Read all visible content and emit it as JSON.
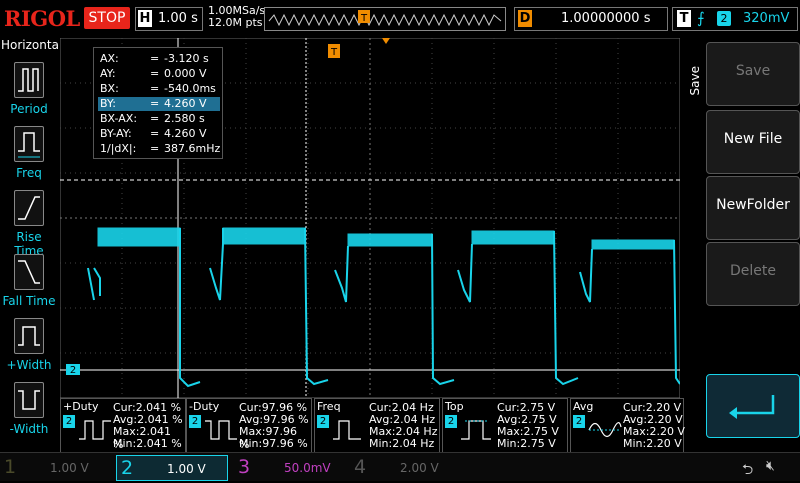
{
  "brand": "RIGOL",
  "run_state": "STOP",
  "horizontal": {
    "key": "H",
    "timebase": "1.00 s",
    "sample_rate": "1.00MSa/s",
    "points": "12.0M pts",
    "delay_key": "D",
    "delay": "1.00000000 s"
  },
  "trigger": {
    "key": "T",
    "channel": "2",
    "level": "320mV"
  },
  "left_panel": {
    "title": "Horizontal",
    "items": [
      "Period",
      "Freq",
      "Rise Time",
      "Fall Time",
      "+Width",
      "-Width"
    ]
  },
  "cursor": {
    "rows": [
      {
        "name": "AX:",
        "value": "-3.120 s"
      },
      {
        "name": "AY:",
        "value": "0.000 V"
      },
      {
        "name": "BX:",
        "value": "-540.0ms"
      },
      {
        "name": "BY:",
        "value": "4.260 V"
      },
      {
        "name": "BX-AX:",
        "value": "2.580 s"
      },
      {
        "name": "BY-AY:",
        "value": "4.260 V"
      },
      {
        "name": "1/|dX|:",
        "value": "387.6mHz"
      }
    ],
    "eq": "="
  },
  "right_panel": {
    "title": "Save",
    "buttons": [
      "Save",
      "New File",
      "NewFolder",
      "Delete"
    ]
  },
  "measurements": [
    {
      "title": "+Duty",
      "ch": "2",
      "cur": "Cur:2.041 %",
      "avg": "Avg:2.041 %",
      "max": "Max:2.041 %",
      "min": "Min:2.041 %"
    },
    {
      "title": "-Duty",
      "ch": "2",
      "cur": "Cur:97.96 %",
      "avg": "Avg:97.96 %",
      "max": "Max:97.96 %",
      "min": "Min:97.96 %"
    },
    {
      "title": "Freq",
      "ch": "2",
      "cur": "Cur:2.04 Hz",
      "avg": "Avg:2.04 Hz",
      "max": "Max:2.04 Hz",
      "min": "Min:2.04 Hz"
    },
    {
      "title": "Top",
      "ch": "2",
      "cur": "Cur:2.75 V",
      "avg": "Avg:2.75 V",
      "max": "Max:2.75 V",
      "min": "Min:2.75 V"
    },
    {
      "title": "Avg",
      "ch": "2",
      "cur": "Cur:2.20 V",
      "avg": "Avg:2.20 V",
      "max": "Max:2.20 V",
      "min": "Min:2.20 V"
    }
  ],
  "channels": [
    {
      "num": "1",
      "scale": "1.00 V",
      "color": "#4a4a2a"
    },
    {
      "num": "2",
      "scale": "1.00 V",
      "color": "#19d4ea"
    },
    {
      "num": "3",
      "scale": "50.0mV",
      "color": "#c040c0"
    },
    {
      "num": "4",
      "scale": "2.00 V",
      "color": "#555555"
    }
  ],
  "markers": {
    "ch2": "2",
    "trig": "T"
  },
  "colors": {
    "accent": "#19d4ea",
    "stop": "#e8251b",
    "trigger": "#f08c00"
  }
}
